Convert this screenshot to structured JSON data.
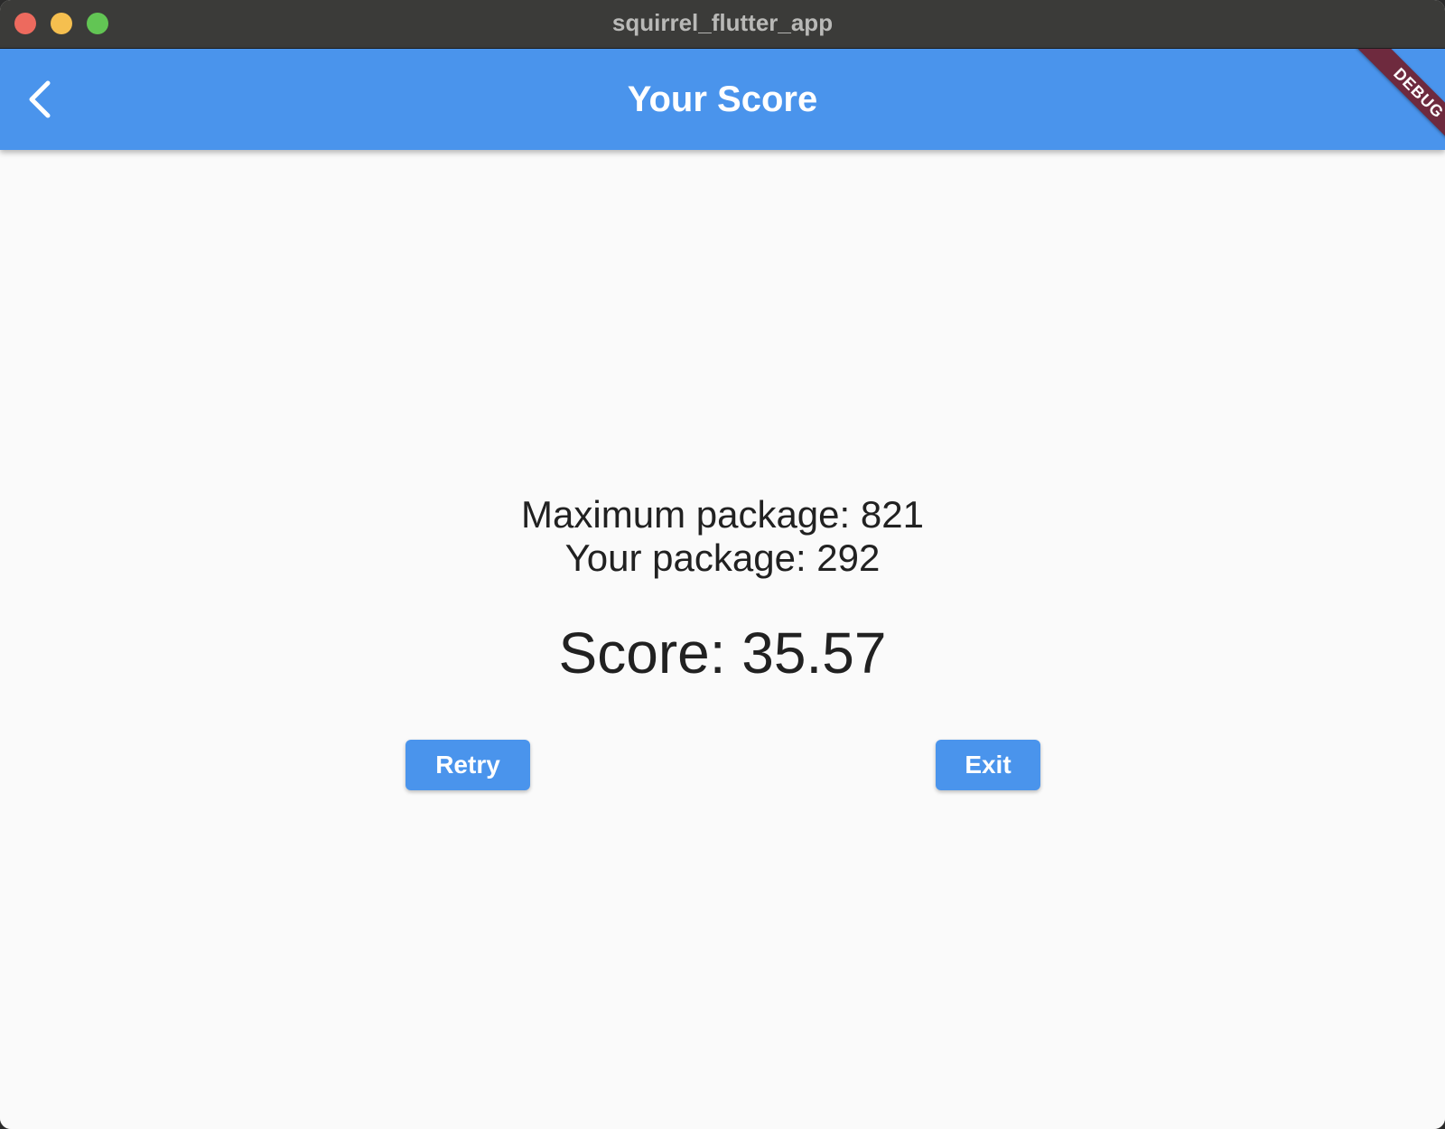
{
  "window": {
    "title": "squirrel_flutter_app",
    "traffic_lights": {
      "close_color": "#ed6a5e",
      "minimize_color": "#f5bf4f",
      "maximize_color": "#62c554"
    }
  },
  "appbar": {
    "title": "Your Score",
    "back_icon": "chevron-left-icon",
    "color": "#4a94ec",
    "debug_banner": "DEBUG"
  },
  "results": {
    "maximum_package": "Maximum package: 821",
    "your_package": "Your package: 292",
    "score": "Score: 35.57"
  },
  "actions": {
    "retry_label": "Retry",
    "exit_label": "Exit",
    "button_color": "#4a94ec"
  }
}
